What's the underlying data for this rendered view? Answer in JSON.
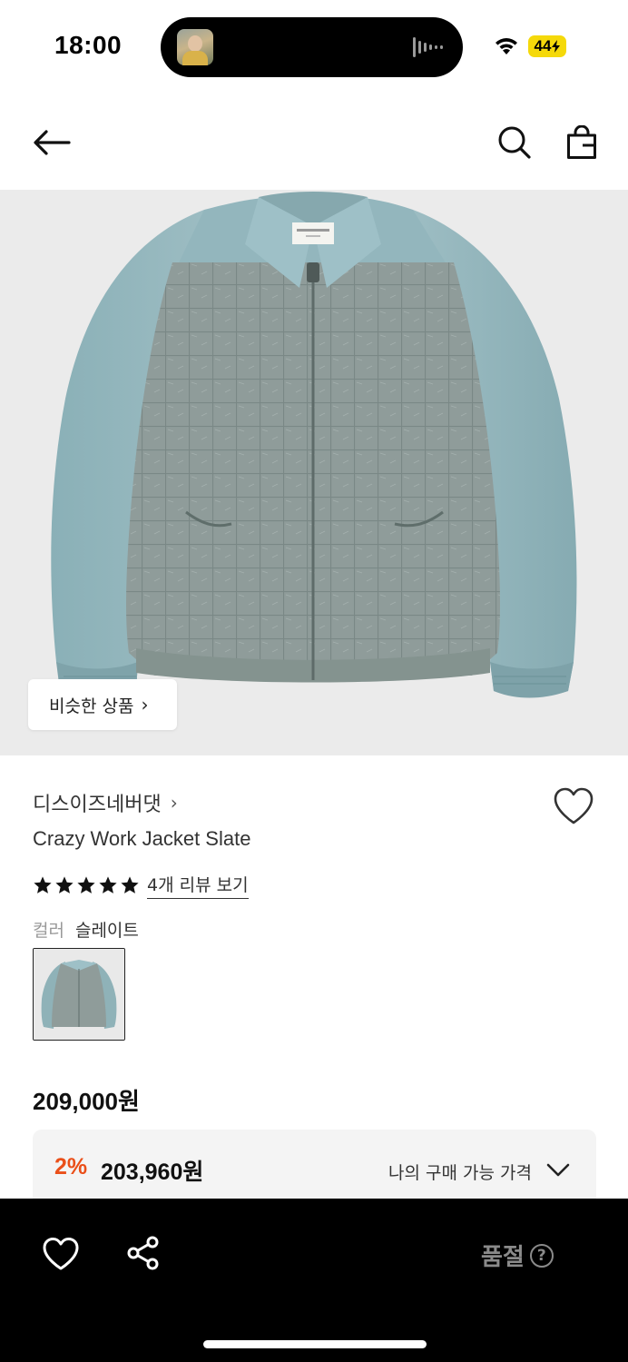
{
  "status_bar": {
    "time": "18:00",
    "battery": "44",
    "icons": [
      "wifi-icon",
      "audio-waveform-icon",
      "battery-charging-icon"
    ]
  },
  "nav": {
    "icons": [
      "back-arrow-icon",
      "search-icon",
      "shopping-bag-icon"
    ]
  },
  "hero": {
    "image_alt": "Crazy Work Jacket Slate",
    "similar_button_label": "비슷한 상품"
  },
  "product": {
    "brand": "디스이즈네버댓",
    "name": "Crazy Work Jacket Slate",
    "rating_stars": 5,
    "review_link": "4개 리뷰 보기",
    "color_label": "컬러",
    "color_value": "슬레이트",
    "price": "209,000원",
    "coupon": {
      "rate": "2%",
      "price": "203,960원",
      "label": "나의 구매 가능 가격"
    }
  },
  "bottom_bar": {
    "soldout_label": "품절",
    "help_glyph": "?",
    "icons": [
      "heart-outline-icon",
      "share-icon",
      "help-circle-icon"
    ]
  },
  "colors": {
    "accent_discount": "#ea4f19",
    "bottom_bar_bg": "#000000",
    "soldout_text": "#8a8a8a",
    "battery": "#f5d90a",
    "jacket_body": "#8e9e9d",
    "jacket_sleeves": "#8fb2b8"
  }
}
